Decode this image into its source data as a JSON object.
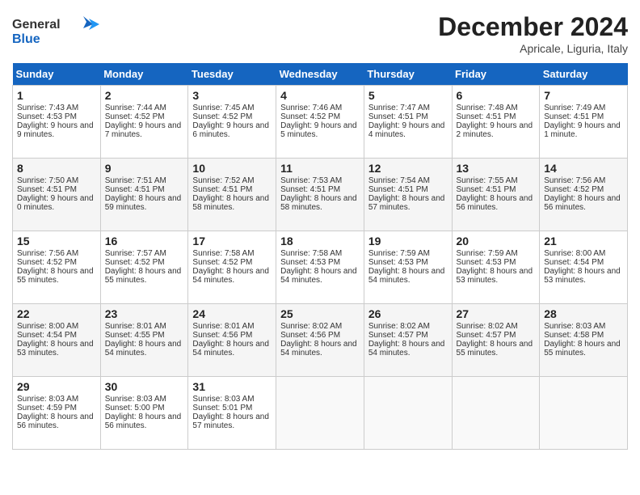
{
  "header": {
    "logo_line1": "General",
    "logo_line2": "Blue",
    "month_title": "December 2024",
    "location": "Apricale, Liguria, Italy"
  },
  "days_of_week": [
    "Sunday",
    "Monday",
    "Tuesday",
    "Wednesday",
    "Thursday",
    "Friday",
    "Saturday"
  ],
  "weeks": [
    [
      {
        "day": "1",
        "sunrise": "7:43 AM",
        "sunset": "4:53 PM",
        "daylight": "9 hours and 9 minutes."
      },
      {
        "day": "2",
        "sunrise": "7:44 AM",
        "sunset": "4:52 PM",
        "daylight": "9 hours and 7 minutes."
      },
      {
        "day": "3",
        "sunrise": "7:45 AM",
        "sunset": "4:52 PM",
        "daylight": "9 hours and 6 minutes."
      },
      {
        "day": "4",
        "sunrise": "7:46 AM",
        "sunset": "4:52 PM",
        "daylight": "9 hours and 5 minutes."
      },
      {
        "day": "5",
        "sunrise": "7:47 AM",
        "sunset": "4:51 PM",
        "daylight": "9 hours and 4 minutes."
      },
      {
        "day": "6",
        "sunrise": "7:48 AM",
        "sunset": "4:51 PM",
        "daylight": "9 hours and 2 minutes."
      },
      {
        "day": "7",
        "sunrise": "7:49 AM",
        "sunset": "4:51 PM",
        "daylight": "9 hours and 1 minute."
      }
    ],
    [
      {
        "day": "8",
        "sunrise": "7:50 AM",
        "sunset": "4:51 PM",
        "daylight": "9 hours and 0 minutes."
      },
      {
        "day": "9",
        "sunrise": "7:51 AM",
        "sunset": "4:51 PM",
        "daylight": "8 hours and 59 minutes."
      },
      {
        "day": "10",
        "sunrise": "7:52 AM",
        "sunset": "4:51 PM",
        "daylight": "8 hours and 58 minutes."
      },
      {
        "day": "11",
        "sunrise": "7:53 AM",
        "sunset": "4:51 PM",
        "daylight": "8 hours and 58 minutes."
      },
      {
        "day": "12",
        "sunrise": "7:54 AM",
        "sunset": "4:51 PM",
        "daylight": "8 hours and 57 minutes."
      },
      {
        "day": "13",
        "sunrise": "7:55 AM",
        "sunset": "4:51 PM",
        "daylight": "8 hours and 56 minutes."
      },
      {
        "day": "14",
        "sunrise": "7:56 AM",
        "sunset": "4:52 PM",
        "daylight": "8 hours and 56 minutes."
      }
    ],
    [
      {
        "day": "15",
        "sunrise": "7:56 AM",
        "sunset": "4:52 PM",
        "daylight": "8 hours and 55 minutes."
      },
      {
        "day": "16",
        "sunrise": "7:57 AM",
        "sunset": "4:52 PM",
        "daylight": "8 hours and 55 minutes."
      },
      {
        "day": "17",
        "sunrise": "7:58 AM",
        "sunset": "4:52 PM",
        "daylight": "8 hours and 54 minutes."
      },
      {
        "day": "18",
        "sunrise": "7:58 AM",
        "sunset": "4:53 PM",
        "daylight": "8 hours and 54 minutes."
      },
      {
        "day": "19",
        "sunrise": "7:59 AM",
        "sunset": "4:53 PM",
        "daylight": "8 hours and 54 minutes."
      },
      {
        "day": "20",
        "sunrise": "7:59 AM",
        "sunset": "4:53 PM",
        "daylight": "8 hours and 53 minutes."
      },
      {
        "day": "21",
        "sunrise": "8:00 AM",
        "sunset": "4:54 PM",
        "daylight": "8 hours and 53 minutes."
      }
    ],
    [
      {
        "day": "22",
        "sunrise": "8:00 AM",
        "sunset": "4:54 PM",
        "daylight": "8 hours and 53 minutes."
      },
      {
        "day": "23",
        "sunrise": "8:01 AM",
        "sunset": "4:55 PM",
        "daylight": "8 hours and 54 minutes."
      },
      {
        "day": "24",
        "sunrise": "8:01 AM",
        "sunset": "4:56 PM",
        "daylight": "8 hours and 54 minutes."
      },
      {
        "day": "25",
        "sunrise": "8:02 AM",
        "sunset": "4:56 PM",
        "daylight": "8 hours and 54 minutes."
      },
      {
        "day": "26",
        "sunrise": "8:02 AM",
        "sunset": "4:57 PM",
        "daylight": "8 hours and 54 minutes."
      },
      {
        "day": "27",
        "sunrise": "8:02 AM",
        "sunset": "4:57 PM",
        "daylight": "8 hours and 55 minutes."
      },
      {
        "day": "28",
        "sunrise": "8:03 AM",
        "sunset": "4:58 PM",
        "daylight": "8 hours and 55 minutes."
      }
    ],
    [
      {
        "day": "29",
        "sunrise": "8:03 AM",
        "sunset": "4:59 PM",
        "daylight": "8 hours and 56 minutes."
      },
      {
        "day": "30",
        "sunrise": "8:03 AM",
        "sunset": "5:00 PM",
        "daylight": "8 hours and 56 minutes."
      },
      {
        "day": "31",
        "sunrise": "8:03 AM",
        "sunset": "5:01 PM",
        "daylight": "8 hours and 57 minutes."
      },
      null,
      null,
      null,
      null
    ]
  ],
  "labels": {
    "sunrise": "Sunrise:",
    "sunset": "Sunset:",
    "daylight": "Daylight:"
  }
}
